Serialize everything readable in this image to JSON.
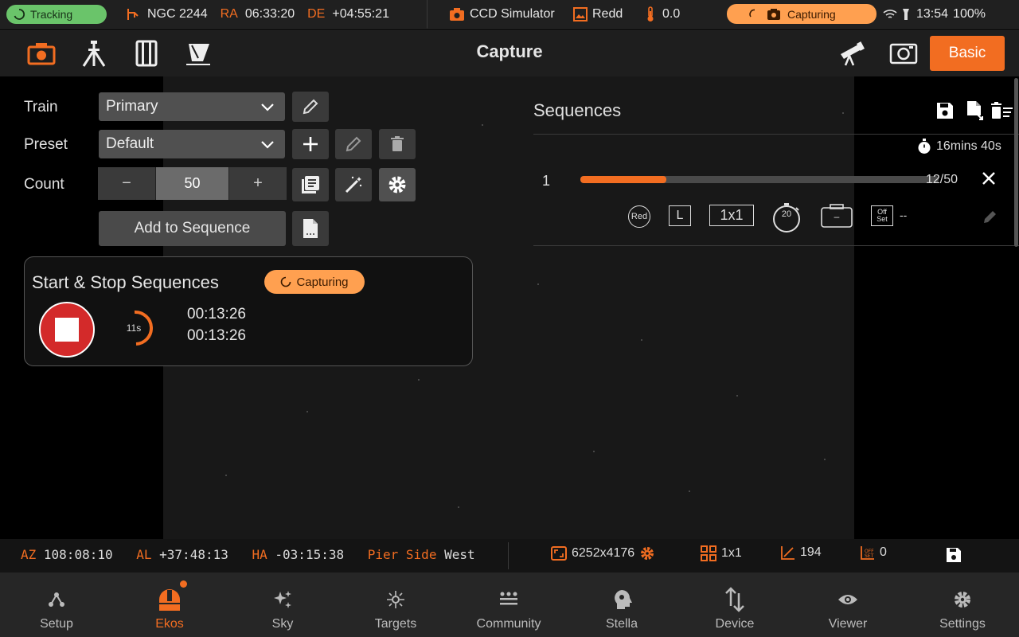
{
  "status": {
    "tracking": "Tracking",
    "target": "NGC 2244",
    "ra_label": "RA",
    "ra": "06:33:20",
    "de_label": "DE",
    "de": "+04:55:21",
    "camera": "CCD Simulator",
    "album": "Redd",
    "temperature": "0.0",
    "capture_state": "Capturing",
    "clock": "13:54",
    "battery": "100%"
  },
  "toolbar": {
    "title": "Capture",
    "mode_button": "Basic"
  },
  "form": {
    "train_label": "Train",
    "train_value": "Primary",
    "preset_label": "Preset",
    "preset_value": "Default",
    "count_label": "Count",
    "count_minus": "−",
    "count_value": "50",
    "count_plus": "+",
    "add_to_sequence": "Add to Sequence"
  },
  "start_stop": {
    "title": "Start & Stop Sequences",
    "status": "Capturing",
    "countdown": "11s",
    "elapsed_1": "00:13:26",
    "elapsed_2": "00:13:26"
  },
  "sequences": {
    "title": "Sequences",
    "total_duration": "16mins 40s",
    "rows": [
      {
        "index": "1",
        "progress": 0.24,
        "count": "12/50",
        "filter": "Red",
        "frame_type": "L",
        "binning": "1x1",
        "exposure": "20",
        "gain": "–",
        "offset_label_1": "Off",
        "offset_label_2": "Set",
        "offset": "--"
      }
    ]
  },
  "info": {
    "az_label": "AZ",
    "az": "108:08:10",
    "al_label": "AL",
    "al": "+37:48:13",
    "ha_label": "HA",
    "ha": "-03:15:38",
    "pier_label": "Pier Side",
    "pier": "West",
    "resolution": "6252x4176",
    "binning": "1x1",
    "gain": "194",
    "offset": "0"
  },
  "nav": [
    {
      "label": "Setup"
    },
    {
      "label": "Ekos"
    },
    {
      "label": "Sky"
    },
    {
      "label": "Targets"
    },
    {
      "label": "Community"
    },
    {
      "label": "Stella"
    },
    {
      "label": "Device"
    },
    {
      "label": "Viewer"
    },
    {
      "label": "Settings"
    }
  ],
  "colors": {
    "accent": "#f26d21",
    "tracking": "#6ac46a",
    "capturing": "#ffa050",
    "stop": "#d32a2a"
  }
}
